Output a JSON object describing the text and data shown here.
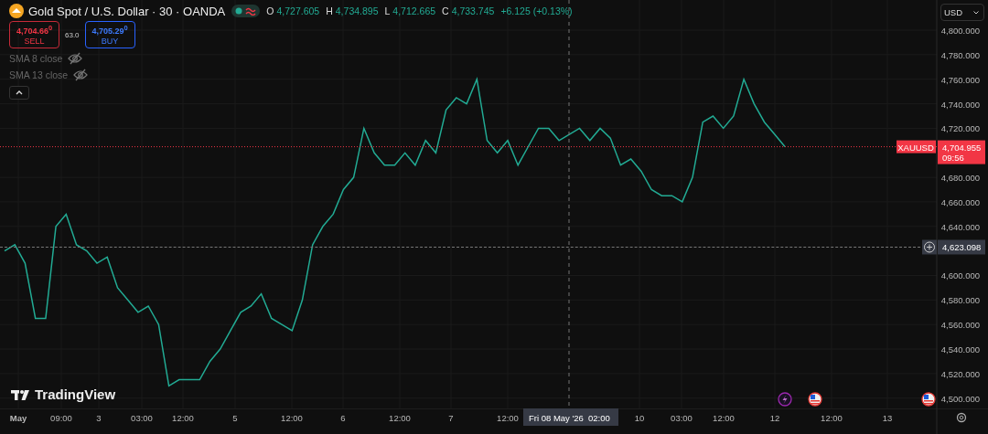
{
  "symbol": {
    "title": "Gold Spot / U.S. Dollar · 30 · OANDA",
    "market_open": true,
    "ohlc": [
      {
        "key": "O",
        "value": "4,727.605"
      },
      {
        "key": "H",
        "value": "4,734.895"
      },
      {
        "key": "L",
        "value": "4,712.665"
      },
      {
        "key": "C",
        "value": "4,733.745"
      }
    ],
    "change": "+6.125 (+0.13%)"
  },
  "trade": {
    "sell_price": "4,704.66$^{0}$",
    "sell_label": "SELL",
    "spread": "63.0",
    "buy_price": "4,705.29$^{0}$",
    "buy_label": "BUY"
  },
  "indicators": [
    {
      "label": "SMA 8 close",
      "visible": false
    },
    {
      "label": "SMA 13 close",
      "visible": false
    }
  ],
  "currency": "USD",
  "last_price": {
    "price": "4,704.955",
    "countdown": "09:56"
  },
  "crosshair": {
    "price": "4,623.098",
    "date": "Fri 08 May '26",
    "time": "02:00"
  },
  "brand": "TradingView",
  "time_axis": [
    "May",
    "09:00",
    "3",
    "03:00",
    "12:00",
    "5",
    "12:00",
    "6",
    "12:00",
    "7",
    "12:00",
    "10",
    "03:00",
    "12:00",
    "12",
    "12:00",
    "13"
  ],
  "events": [
    {
      "kind": "lightning"
    },
    {
      "kind": "flag"
    },
    {
      "kind": "flag"
    }
  ],
  "chart_data": {
    "type": "line",
    "ylim": [
      4491.6,
      4824.6
    ],
    "grid": true,
    "yticks": [
      {
        "value": 4500,
        "label": "4,500.000"
      },
      {
        "value": 4520,
        "label": "4,520.000"
      },
      {
        "value": 4540,
        "label": "4,540.000"
      },
      {
        "value": 4560,
        "label": "4,560.000"
      },
      {
        "value": 4580,
        "label": "4,580.000"
      },
      {
        "value": 4600,
        "label": "4,600.000"
      },
      {
        "value": 4640,
        "label": "4,640.000"
      },
      {
        "value": 4660,
        "label": "4,660.000"
      },
      {
        "value": 4680,
        "label": "4,680.000"
      },
      {
        "value": 4720,
        "label": "4,720.000"
      },
      {
        "value": 4740,
        "label": "4,740.000"
      },
      {
        "value": 4760,
        "label": "4,760.000"
      },
      {
        "value": 4780,
        "label": "4,780.000"
      },
      {
        "value": 4800,
        "label": "4,800.000"
      }
    ],
    "series": [
      {
        "name": "XAUUSD",
        "color": "#22ab94",
        "values": [
          4620,
          4625,
          4610,
          4565,
          4565,
          4640,
          4650,
          4625,
          4620,
          4610,
          4615,
          4590,
          4580,
          4570,
          4575,
          4560,
          4510,
          4515,
          4515,
          4515,
          4530,
          4540,
          4555,
          4570,
          4575,
          4585,
          4565,
          4560,
          4555,
          4580,
          4625,
          4640,
          4650,
          4670,
          4680,
          4720,
          4700,
          4690,
          4690,
          4700,
          4690,
          4710,
          4700,
          4735,
          4745,
          4740,
          4760,
          4710,
          4700,
          4710,
          4690,
          4705,
          4720,
          4720,
          4710,
          4715,
          4720,
          4710,
          4720,
          4712,
          4690,
          4695,
          4685,
          4670,
          4665,
          4665,
          4660,
          4680,
          4725,
          4730,
          4720,
          4730,
          4760,
          4740,
          4725,
          4715,
          4705
        ]
      }
    ]
  }
}
